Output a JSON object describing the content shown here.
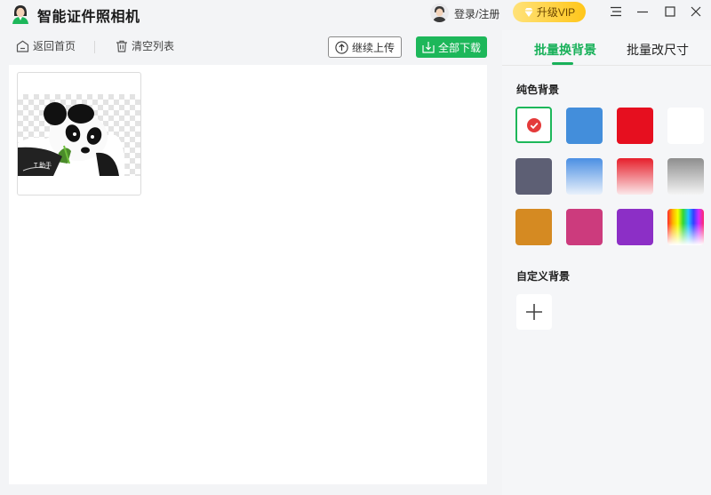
{
  "app": {
    "title": "智能证件照相机"
  },
  "header": {
    "login_label": "登录/注册",
    "vip_label": "升级VIP"
  },
  "toolbar": {
    "back_label": "返回首页",
    "clear_label": "清空列表",
    "upload_label": "继续上传",
    "download_all_label": "全部下载"
  },
  "thumbnail": {
    "watermark_text": "T 助手"
  },
  "panel": {
    "tabs": [
      {
        "label": "批量换背景",
        "active": true
      },
      {
        "label": "批量改尺寸",
        "active": false
      }
    ],
    "solid_title": "纯色背景",
    "custom_title": "自定义背景",
    "swatches": [
      {
        "name": "white-selected",
        "color": "#ffffff",
        "selected": true
      },
      {
        "name": "blue",
        "color": "#438edb"
      },
      {
        "name": "red",
        "color": "#e60f1f"
      },
      {
        "name": "white",
        "color": "#ffffff"
      },
      {
        "name": "slate",
        "color": "#5d5f74"
      },
      {
        "name": "blue-gradient",
        "color": "#4b8fe3"
      },
      {
        "name": "red-gradient",
        "color": "#e61f2b"
      },
      {
        "name": "gray-gradient",
        "color": "#8e8e8e"
      },
      {
        "name": "orange",
        "color": "#d58a22"
      },
      {
        "name": "pink",
        "color": "#cc3b7d"
      },
      {
        "name": "purple",
        "color": "#8c2fc6"
      },
      {
        "name": "rainbow",
        "color": "multicolor"
      }
    ]
  },
  "colors": {
    "accent": "#1db75a",
    "vip": "#ffc61a"
  }
}
